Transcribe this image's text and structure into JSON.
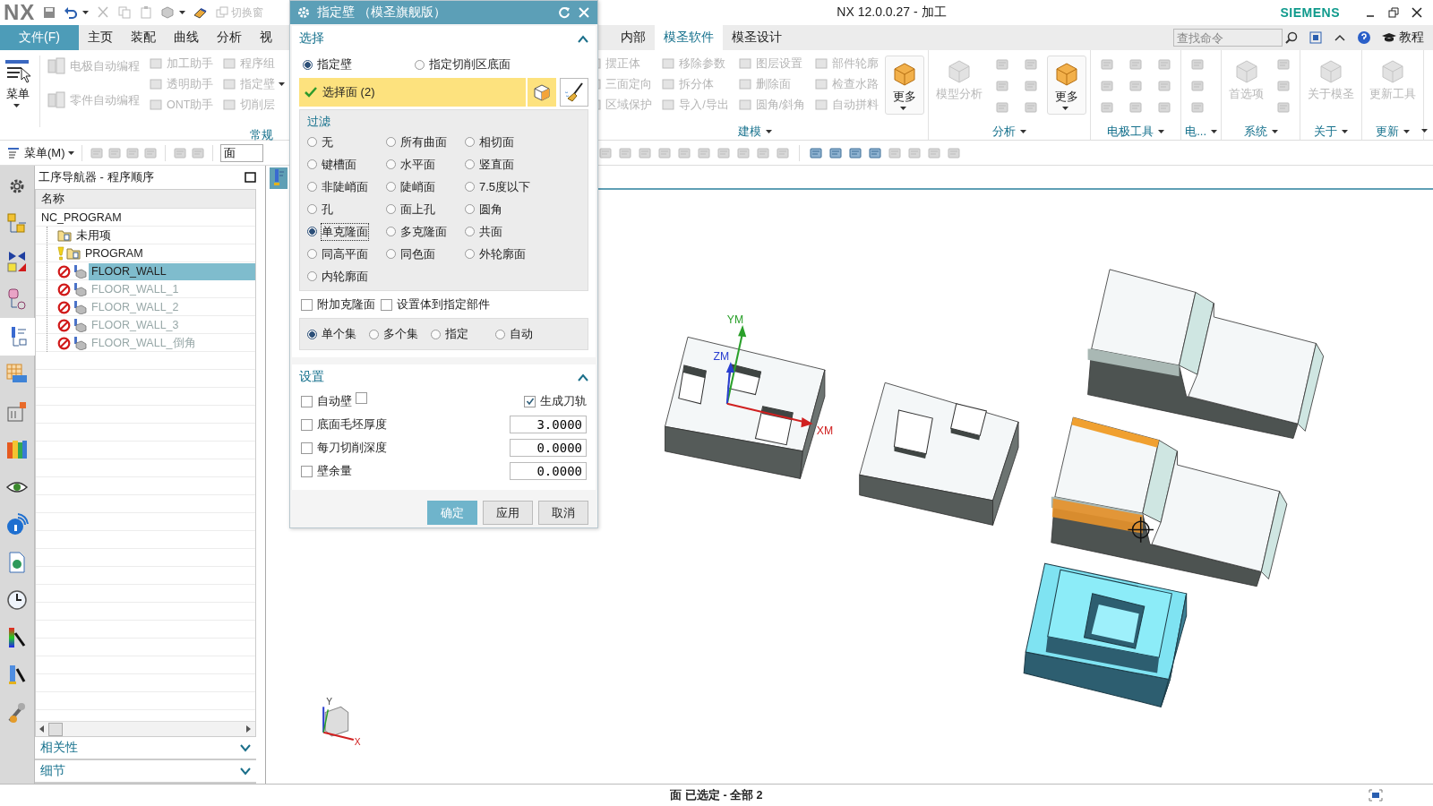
{
  "title_bar": {
    "logo": "NX",
    "switch_window": "切换窗",
    "title": "NX 12.0.0.27 - 加工",
    "brand": "SIEMENS"
  },
  "menu_tabs": [
    {
      "label": "文件(F)",
      "kind": "file",
      "selected": false
    },
    {
      "label": "主页",
      "kind": "tab",
      "selected": false
    },
    {
      "label": "装配",
      "kind": "tab",
      "selected": false
    },
    {
      "label": "曲线",
      "kind": "tab",
      "selected": false
    },
    {
      "label": "分析",
      "kind": "tab",
      "selected": false
    },
    {
      "label": "视",
      "kind": "tab",
      "selected": false
    }
  ],
  "menu_tabs_right": [
    {
      "label": "内部",
      "selected": false
    },
    {
      "label": "模圣软件",
      "selected": true
    },
    {
      "label": "模圣设计",
      "selected": false
    }
  ],
  "search": {
    "placeholder": "查找命令"
  },
  "help_link": "教程",
  "ribbon_left": {
    "menu_button": {
      "label": "菜单",
      "disabled": false
    },
    "group_label": "常规",
    "columns": [
      [
        {
          "label": "电极自动编程",
          "disabled": true
        },
        {
          "label": "零件自动编程",
          "disabled": true
        }
      ],
      [
        {
          "label": "加工助手",
          "disabled": true
        },
        {
          "label": "透明助手",
          "disabled": true
        },
        {
          "label": "ONT助手",
          "disabled": true
        }
      ],
      [
        {
          "label": "程序组",
          "disabled": true
        },
        {
          "label": "指定壁",
          "disabled": true
        },
        {
          "label": "切削层",
          "disabled": true
        }
      ]
    ]
  },
  "ribbon_right": [
    {
      "label": "建模",
      "entries": [
        {
          "kind": "column",
          "items": [
            {
              "label": "摆正体",
              "disabled": true
            },
            {
              "label": "三面定向",
              "disabled": true
            },
            {
              "label": "区域保护",
              "disabled": true
            }
          ]
        },
        {
          "kind": "column",
          "items": [
            {
              "label": "移除参数",
              "disabled": true
            },
            {
              "label": "拆分体",
              "disabled": true
            },
            {
              "label": "导入/导出",
              "disabled": true
            }
          ]
        },
        {
          "kind": "column",
          "items": [
            {
              "label": "图层设置",
              "disabled": true
            },
            {
              "label": "删除面",
              "disabled": true
            },
            {
              "label": "圆角/斜角",
              "disabled": true
            }
          ]
        },
        {
          "kind": "column",
          "items": [
            {
              "label": "部件轮廓",
              "disabled": true
            },
            {
              "label": "检查水路",
              "disabled": true
            },
            {
              "label": "自动拼料",
              "disabled": true
            }
          ]
        },
        {
          "kind": "big",
          "label": "更多",
          "disabled": false
        }
      ]
    },
    {
      "label": "分析",
      "entries": [
        {
          "kind": "big",
          "label": "模型分析",
          "disabled": true
        },
        {
          "kind": "icons"
        },
        {
          "kind": "icons"
        },
        {
          "kind": "big",
          "label": "更多",
          "disabled": false
        }
      ]
    },
    {
      "label": "电极工具",
      "entries": [
        {
          "kind": "icons"
        },
        {
          "kind": "icons"
        },
        {
          "kind": "icons"
        }
      ]
    },
    {
      "label": "电...",
      "entries": [
        {
          "kind": "icons"
        }
      ]
    },
    {
      "label": "系统",
      "entries": [
        {
          "kind": "big",
          "label": "首选项",
          "disabled": true
        },
        {
          "kind": "icons"
        }
      ]
    },
    {
      "label": "关于",
      "entries": [
        {
          "kind": "big",
          "label": "关于模圣",
          "disabled": true
        }
      ]
    },
    {
      "label": "更新",
      "entries": [
        {
          "kind": "big",
          "label": "更新工具",
          "disabled": true
        }
      ]
    }
  ],
  "toolbar": {
    "menu": "菜单(M)",
    "filter_value": "面"
  },
  "navigator": {
    "title": "工序导航器 - 程序顺序",
    "column": "名称",
    "tree": [
      {
        "label": "NC_PROGRAM",
        "selected": false,
        "disabled": false,
        "children": [
          {
            "label": "未用项",
            "kind": "group",
            "selected": false,
            "disabled": false
          },
          {
            "label": "PROGRAM",
            "kind": "program",
            "selected": false,
            "disabled": false
          },
          {
            "label": "FLOOR_WALL",
            "kind": "operation",
            "selected": true,
            "disabled": false
          },
          {
            "label": "FLOOR_WALL_1",
            "kind": "operation",
            "selected": false,
            "disabled": true
          },
          {
            "label": "FLOOR_WALL_2",
            "kind": "operation",
            "selected": false,
            "disabled": true
          },
          {
            "label": "FLOOR_WALL_3",
            "kind": "operation",
            "selected": false,
            "disabled": true
          },
          {
            "label": "FLOOR_WALL_倒角",
            "kind": "operation",
            "selected": false,
            "disabled": true
          }
        ]
      }
    ],
    "sections": [
      {
        "label": "相关性",
        "expanded": false
      },
      {
        "label": "细节",
        "expanded": false
      }
    ]
  },
  "dialog": {
    "title": "指定壁 （模圣旗舰版）",
    "select_section": {
      "title": "选择",
      "expanded": true,
      "targets": [
        {
          "label": "指定壁",
          "selected": true
        },
        {
          "label": "指定切削区底面",
          "selected": false
        }
      ],
      "selection": {
        "label": "选择面 (2)",
        "done": true
      },
      "filter": {
        "title": "过滤",
        "options": [
          {
            "label": "无",
            "selected": false
          },
          {
            "label": "所有曲面",
            "selected": false
          },
          {
            "label": "相切面",
            "selected": false
          },
          {
            "label": "键槽面",
            "selected": false
          },
          {
            "label": "水平面",
            "selected": false
          },
          {
            "label": "竖直面",
            "selected": false
          },
          {
            "label": "非陡峭面",
            "selected": false
          },
          {
            "label": "陡峭面",
            "selected": false
          },
          {
            "label": "7.5度以下",
            "selected": false
          },
          {
            "label": "孔",
            "selected": false
          },
          {
            "label": "面上孔",
            "selected": false
          },
          {
            "label": "圆角",
            "selected": false
          },
          {
            "label": "单克隆面",
            "selected": true
          },
          {
            "label": "多克隆面",
            "selected": false
          },
          {
            "label": "共面",
            "selected": false
          },
          {
            "label": "同高平面",
            "selected": false
          },
          {
            "label": "同色面",
            "selected": false
          },
          {
            "label": "外轮廓面",
            "selected": false
          },
          {
            "label": "内轮廓面",
            "selected": false
          }
        ]
      },
      "options": [
        {
          "label": "附加克隆面",
          "checked": false
        },
        {
          "label": "设置体到指定部件",
          "checked": false
        }
      ],
      "sets": [
        {
          "label": "单个集",
          "selected": true
        },
        {
          "label": "多个集",
          "selected": false
        },
        {
          "label": "指定",
          "selected": false
        },
        {
          "label": "自动",
          "selected": false
        }
      ]
    },
    "settings_section": {
      "title": "设置",
      "expanded": true,
      "auto_wall": {
        "label": "自动壁",
        "checked": false,
        "extra_checked": false
      },
      "generate": {
        "label": "生成刀轨",
        "checked": true
      },
      "params": [
        {
          "label": "底面毛坯厚度",
          "checked": false,
          "value": "3.0000"
        },
        {
          "label": "每刀切削深度",
          "checked": false,
          "value": "0.0000"
        },
        {
          "label": "壁余量",
          "checked": false,
          "value": "0.0000"
        }
      ]
    },
    "buttons": [
      {
        "label": "确定",
        "kind": "primary"
      },
      {
        "label": "应用",
        "kind": "normal"
      },
      {
        "label": "取消",
        "kind": "normal"
      }
    ]
  },
  "graphics": {
    "axes": [
      "YM",
      "ZM",
      "XM"
    ],
    "mini_axes": [
      "Y",
      "X"
    ]
  },
  "status_bar": {
    "message": "面 已选定 - 全部 2"
  }
}
